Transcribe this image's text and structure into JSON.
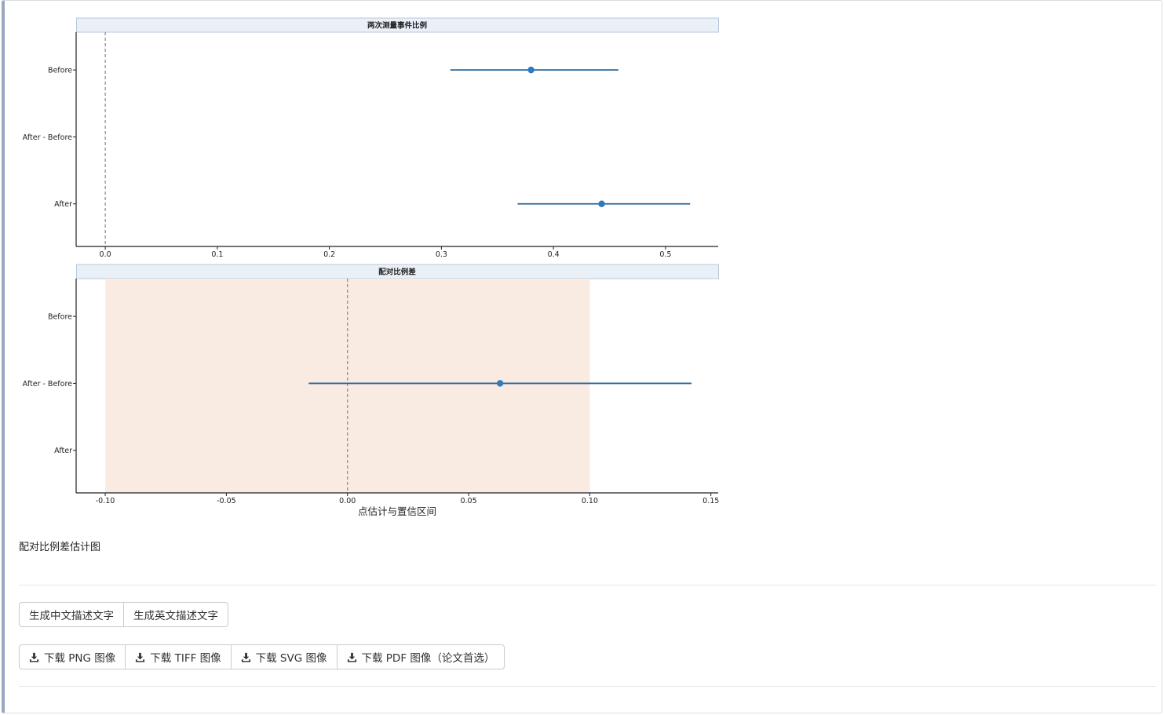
{
  "chart_data": [
    {
      "type": "forest",
      "title": "两次测量事件比例",
      "categories": [
        "Before",
        "After - Before",
        "After"
      ],
      "points": [
        {
          "label": "Before",
          "estimate": 0.38,
          "lower": 0.308,
          "upper": 0.458
        },
        {
          "label": "After",
          "estimate": 0.443,
          "lower": 0.368,
          "upper": 0.522
        }
      ],
      "xlim": [
        -0.026,
        0.547
      ],
      "xticks": [
        "0.0",
        "0.1",
        "0.2",
        "0.3",
        "0.4",
        "0.5"
      ],
      "xtick_values": [
        0,
        0.1,
        0.2,
        0.3,
        0.4,
        0.5
      ],
      "ref_line": 0,
      "xlabel": "",
      "grid": false
    },
    {
      "type": "forest",
      "title": "配对比例差",
      "categories": [
        "Before",
        "After - Before",
        "After"
      ],
      "points": [
        {
          "label": "After - Before",
          "estimate": 0.063,
          "lower": -0.016,
          "upper": 0.142
        }
      ],
      "shaded_band": [
        -0.1,
        0.1
      ],
      "xlim": [
        -0.112,
        0.153
      ],
      "xticks": [
        "-0.10",
        "-0.05",
        "0.00",
        "0.05",
        "0.10",
        "0.15"
      ],
      "xtick_values": [
        -0.1,
        -0.05,
        0,
        0.05,
        0.1,
        0.15
      ],
      "ref_line": 0,
      "xlabel": "点估计与置信区间",
      "grid": false
    }
  ],
  "colors": {
    "point": "#2e7bbf",
    "line": "#2a6496",
    "band": "#f9ebe2",
    "strip": "#eaf0f8",
    "ref": "#888888"
  },
  "caption": "配对比例差估计图",
  "describe_buttons": [
    {
      "label": "生成中文描述文字"
    },
    {
      "label": "生成英文描述文字"
    }
  ],
  "download_buttons": [
    {
      "label": "下载 PNG 图像",
      "icon": "download-icon"
    },
    {
      "label": "下载 TIFF 图像",
      "icon": "download-icon"
    },
    {
      "label": "下载 SVG 图像",
      "icon": "download-icon"
    },
    {
      "label": "下载 PDF 图像（论文首选）",
      "icon": "download-icon"
    }
  ]
}
